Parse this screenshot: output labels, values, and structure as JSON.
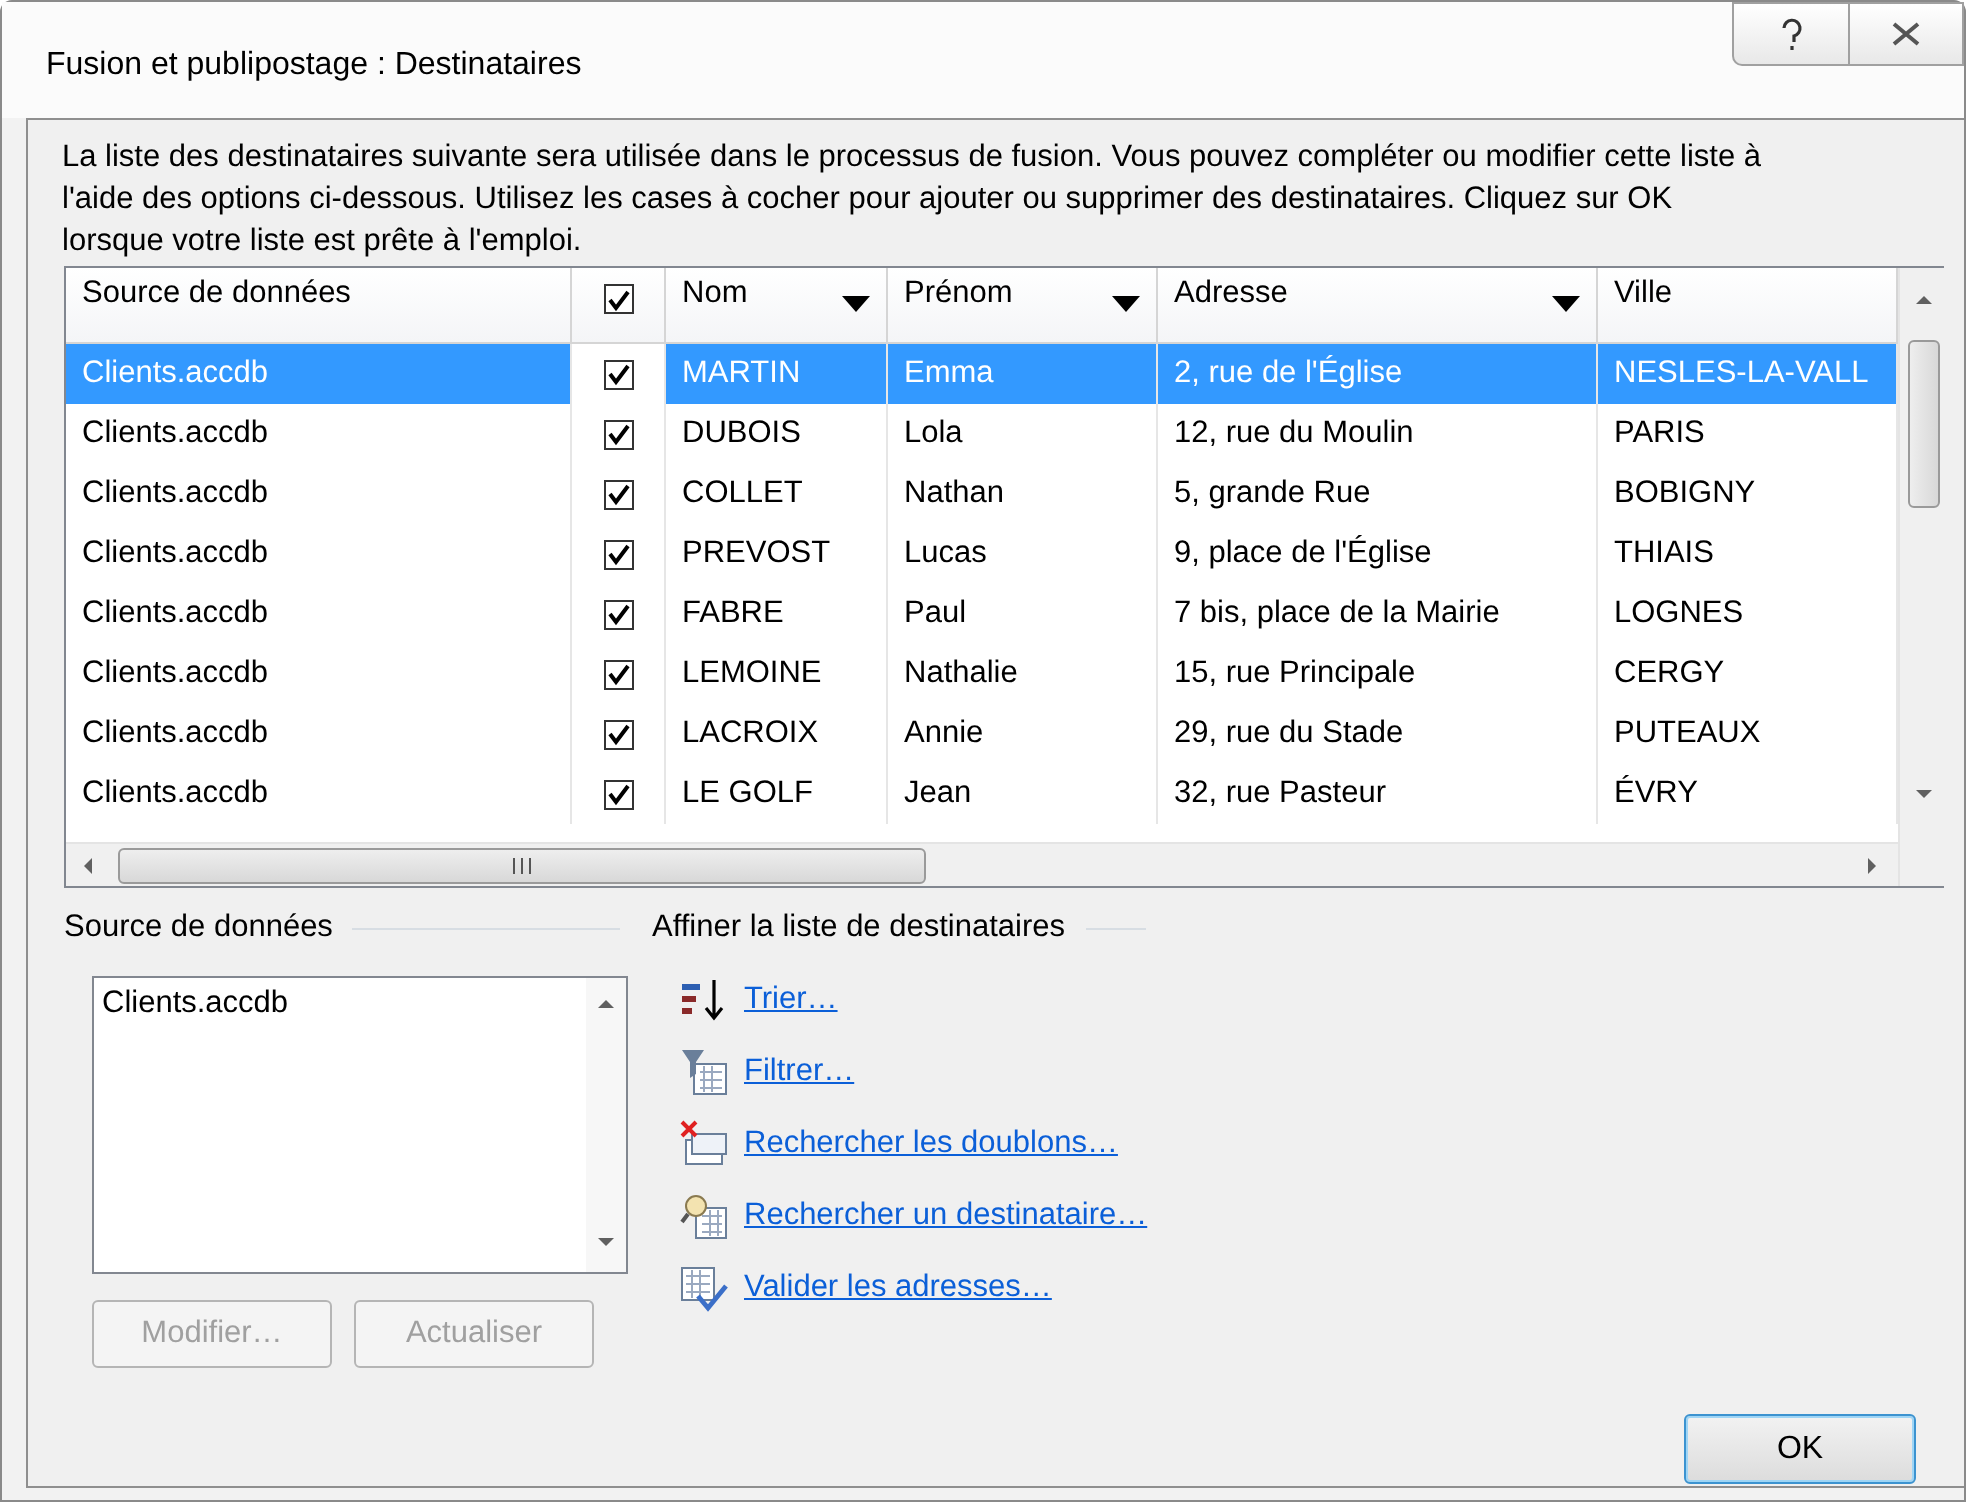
{
  "window": {
    "title": "Fusion et publipostage : Destinataires"
  },
  "intro": "La liste des destinataires suivante sera utilisée dans le processus de fusion. Vous pouvez compléter ou modifier cette liste à l'aide des options ci-dessous. Utilisez les cases à cocher pour ajouter ou supprimer des destinataires. Cliquez sur OK lorsque votre liste est prête à l'emploi.",
  "table": {
    "columns": [
      {
        "kind": "plain",
        "label": "Source de données"
      },
      {
        "kind": "checkbox",
        "checked": true
      },
      {
        "kind": "menu",
        "label": "Nom"
      },
      {
        "kind": "menu",
        "label": "Prénom"
      },
      {
        "kind": "menu",
        "label": "Adresse"
      },
      {
        "kind": "plain",
        "label": "Ville"
      }
    ],
    "rows": [
      {
        "selected": true,
        "cells": [
          "Clients.accdb",
          {
            "checked": true
          },
          "MARTIN",
          "Emma",
          "2, rue de l'Église",
          "NESLES-LA-VALL"
        ]
      },
      {
        "selected": false,
        "cells": [
          "Clients.accdb",
          {
            "checked": true
          },
          "DUBOIS",
          "Lola",
          "12, rue du Moulin",
          "PARIS"
        ]
      },
      {
        "selected": false,
        "cells": [
          "Clients.accdb",
          {
            "checked": true
          },
          "COLLET",
          "Nathan",
          "5, grande Rue",
          "BOBIGNY"
        ]
      },
      {
        "selected": false,
        "cells": [
          "Clients.accdb",
          {
            "checked": true
          },
          "PREVOST",
          "Lucas",
          "9, place de l'Église",
          "THIAIS"
        ]
      },
      {
        "selected": false,
        "cells": [
          "Clients.accdb",
          {
            "checked": true
          },
          "FABRE",
          "Paul",
          "7 bis, place de la Mairie",
          "LOGNES"
        ]
      },
      {
        "selected": false,
        "cells": [
          "Clients.accdb",
          {
            "checked": true
          },
          "LEMOINE",
          "Nathalie",
          "15, rue Principale",
          "CERGY"
        ]
      },
      {
        "selected": false,
        "cells": [
          "Clients.accdb",
          {
            "checked": true
          },
          "LACROIX",
          "Annie",
          "29, rue du Stade",
          "PUTEAUX"
        ]
      },
      {
        "selected": false,
        "cells": [
          "Clients.accdb",
          {
            "checked": true
          },
          "LE GOLF",
          "Jean",
          "32, rue Pasteur",
          "ÉVRY"
        ]
      }
    ]
  },
  "source_panel": {
    "label": "Source de données",
    "items": [
      "Clients.accdb"
    ],
    "buttons": [
      {
        "label": "Modifier…",
        "disabled": true
      },
      {
        "label": "Actualiser",
        "disabled": true
      }
    ]
  },
  "refine": {
    "label": "Affiner la liste de destinataires",
    "links": [
      {
        "kind": "sort",
        "label": "Trier…"
      },
      {
        "kind": "filter",
        "label": "Filtrer…"
      },
      {
        "kind": "duplicates",
        "label": "Rechercher les doublons…"
      },
      {
        "kind": "find",
        "label": "Rechercher un destinataire…"
      },
      {
        "kind": "validate",
        "label": "Valider les adresses…"
      }
    ]
  },
  "ok_button": {
    "label": "OK"
  }
}
